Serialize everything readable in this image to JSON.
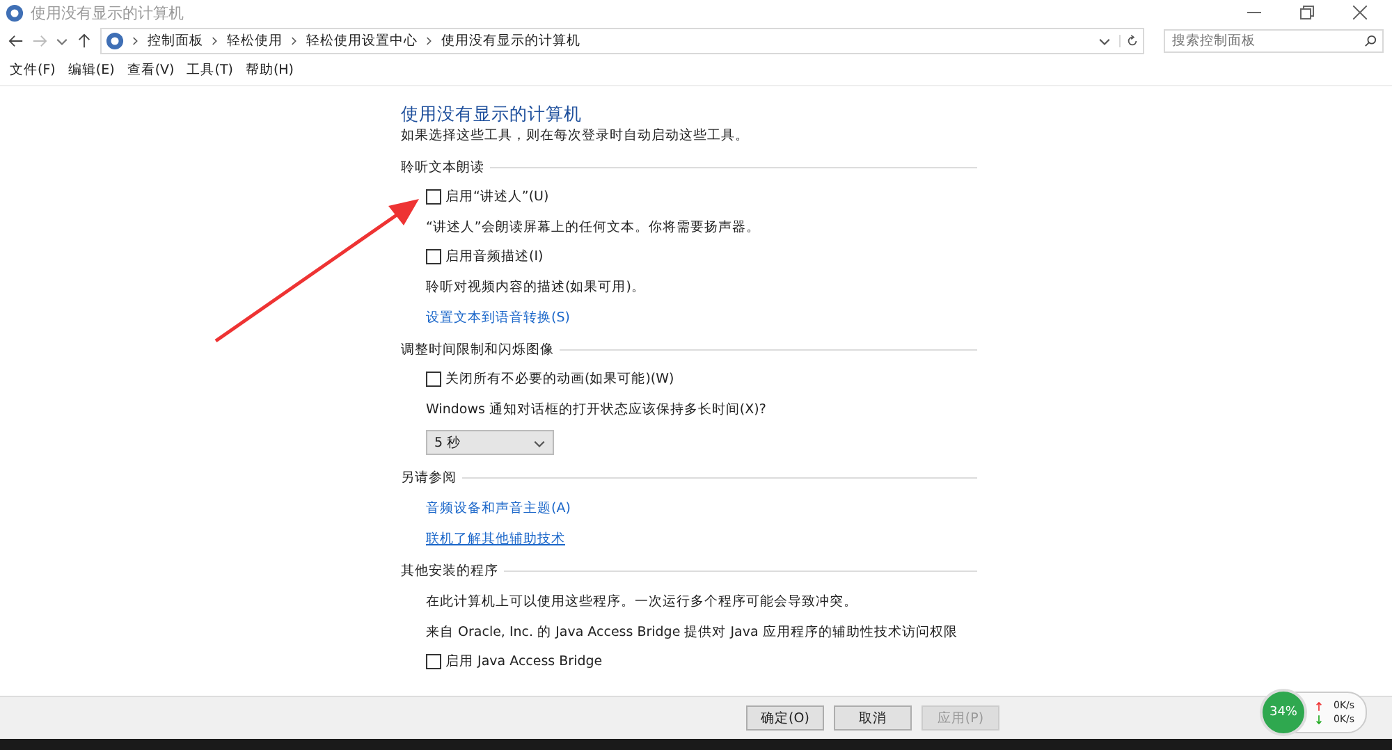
{
  "window": {
    "title": "使用没有显示的计算机"
  },
  "address": {
    "crumbs": [
      "控制面板",
      "轻松使用",
      "轻松使用设置中心",
      "使用没有显示的计算机"
    ],
    "search_placeholder": "搜索控制面板"
  },
  "menu": [
    "文件(F)",
    "编辑(E)",
    "查看(V)",
    "工具(T)",
    "帮助(H)"
  ],
  "page": {
    "title": "使用没有显示的计算机",
    "intro": "如果选择这些工具，则在每次登录时自动启动这些工具。",
    "sections": [
      {
        "heading": "聆听文本朗读",
        "items": [
          {
            "kind": "checkbox",
            "label": "启用“讲述人”(U)",
            "checked": false
          },
          {
            "kind": "note",
            "text": "“讲述人”会朗读屏幕上的任何文本。你将需要扬声器。"
          },
          {
            "kind": "checkbox",
            "label": "启用音频描述(I)",
            "checked": false
          },
          {
            "kind": "note",
            "text": "聆听对视频内容的描述(如果可用)。"
          },
          {
            "kind": "link",
            "text": "设置文本到语音转换(S)",
            "underlined": false
          }
        ]
      },
      {
        "heading": "调整时间限制和闪烁图像",
        "items": [
          {
            "kind": "checkbox",
            "label": "关闭所有不必要的动画(如果可能)(W)",
            "checked": false
          },
          {
            "kind": "note",
            "text": "Windows 通知对话框的打开状态应该保持多长时间(X)?"
          },
          {
            "kind": "dropdown",
            "value": "5 秒"
          }
        ]
      },
      {
        "heading": "另请参阅",
        "items": [
          {
            "kind": "link",
            "text": "音频设备和声音主题(A)",
            "underlined": false
          },
          {
            "kind": "link",
            "text": "联机了解其他辅助技术",
            "underlined": true
          }
        ]
      },
      {
        "heading": "其他安装的程序",
        "items": [
          {
            "kind": "note",
            "text": "在此计算机上可以使用这些程序。一次运行多个程序可能会导致冲突。"
          },
          {
            "kind": "note",
            "text": "来自 Oracle, Inc. 的 Java Access Bridge 提供对 Java 应用程序的辅助性技术访问权限"
          },
          {
            "kind": "checkbox",
            "label": "启用 Java Access Bridge",
            "checked": false
          }
        ]
      }
    ]
  },
  "buttons": [
    {
      "label": "确定(O)",
      "disabled": false
    },
    {
      "label": "取消",
      "disabled": false
    },
    {
      "label": "应用(P)",
      "disabled": true
    }
  ],
  "speed_widget": {
    "percent": "34%",
    "upload": "0K/s",
    "download": "0K/s"
  }
}
